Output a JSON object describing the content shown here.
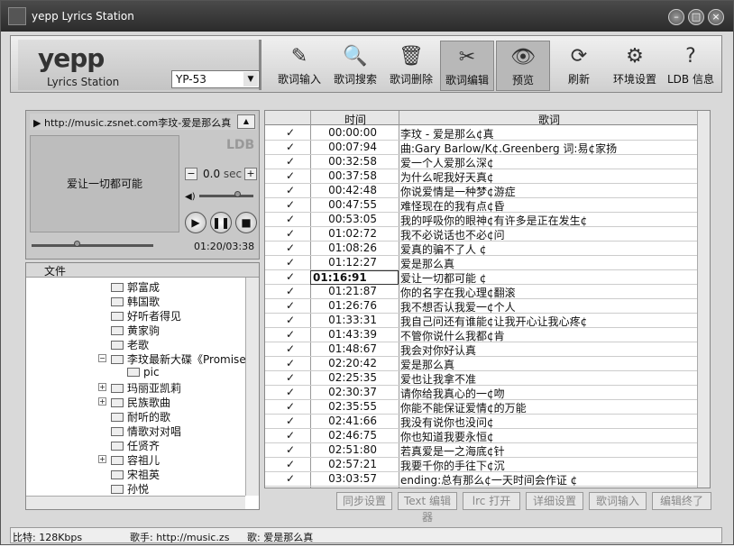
{
  "window": {
    "title": "yepp Lyrics Station"
  },
  "brand": {
    "name": "yepp",
    "subtitle": "Lyrics Station",
    "model": "YP-53"
  },
  "toolbar": [
    {
      "label": "歌词输入",
      "icon": "lyrics-input-icon"
    },
    {
      "label": "歌词搜索",
      "icon": "lyrics-search-icon"
    },
    {
      "label": "歌词删除",
      "icon": "trash-icon"
    },
    {
      "label": "歌词编辑",
      "icon": "scissors-icon",
      "active": true
    },
    {
      "label": "预览",
      "icon": "eye-icon",
      "active": true
    },
    {
      "label": "刷新",
      "icon": "refresh-icon"
    },
    {
      "label": "环境设置",
      "icon": "settings-icon"
    },
    {
      "label": "LDB 信息",
      "icon": "help-icon"
    }
  ],
  "player": {
    "url": "http://music.zsnet.com李玟-爱是那么真",
    "lyric": "爱让一切都可能",
    "sec_value": "0.0",
    "sec_label": "sec",
    "time": "01:20/03:38",
    "progress": 0.37,
    "volume": 0.7
  },
  "tree": {
    "header": "文件",
    "items": [
      {
        "label": "郭富成",
        "indent": 1
      },
      {
        "label": "韩国歌",
        "indent": 1
      },
      {
        "label": "好听者得见",
        "indent": 1
      },
      {
        "label": "黄家驹",
        "indent": 1
      },
      {
        "label": "老歌",
        "indent": 1
      },
      {
        "label": "李玟最新大碟《Promise",
        "indent": 1,
        "expanded": true
      },
      {
        "label": "pic",
        "indent": 2
      },
      {
        "label": "玛丽亚凯莉",
        "indent": 1,
        "plus": true
      },
      {
        "label": "民族歌曲",
        "indent": 1,
        "plus": true
      },
      {
        "label": "耐听的歌",
        "indent": 1
      },
      {
        "label": "情歌对对唱",
        "indent": 1
      },
      {
        "label": "任贤齐",
        "indent": 1
      },
      {
        "label": "容祖儿",
        "indent": 1,
        "plus": true
      },
      {
        "label": "宋祖英",
        "indent": 1
      },
      {
        "label": "孙悦",
        "indent": 1
      }
    ]
  },
  "grid": {
    "col_time": "时间",
    "col_lyrics": "歌词",
    "rows": [
      {
        "t": "00:00:00",
        "l": "李玟 - 爱是那么¢真"
      },
      {
        "t": "00:07:94",
        "l": "曲:Gary Barlow/K¢.Greenberg 词:易¢家扬"
      },
      {
        "t": "00:32:58",
        "l": "爱一个人爱那么深¢"
      },
      {
        "t": "00:37:58",
        "l": "为什么呢我好天真¢"
      },
      {
        "t": "00:42:48",
        "l": "你说爱情是一种梦¢游症"
      },
      {
        "t": "00:47:55",
        "l": "难怪现在的我有点¢昏"
      },
      {
        "t": "00:53:05",
        "l": "我的呼吸你的眼神¢有许多是正在发生¢"
      },
      {
        "t": "01:02:72",
        "l": "我不必说话也不必¢问"
      },
      {
        "t": "01:08:26",
        "l": "爱真的骗不了人 ¢"
      },
      {
        "t": "01:12:27",
        "l": "爱是那么真"
      },
      {
        "t": "01:16:91",
        "l": "爱让一切都可能 ¢",
        "editing": true
      },
      {
        "t": "01:21:87",
        "l": "你的名字在我心理¢翻滚"
      },
      {
        "t": "01:26:76",
        "l": "我不想否认我爱一¢个人"
      },
      {
        "t": "01:33:31",
        "l": "我自己问还有谁能¢让我开心让我心疼¢"
      },
      {
        "t": "01:43:39",
        "l": "不管你说什么我都¢肯"
      },
      {
        "t": "01:48:67",
        "l": "我会对你好认真"
      },
      {
        "t": "02:20:42",
        "l": "爱是那么真"
      },
      {
        "t": "02:25:35",
        "l": "爱也让我拿不准"
      },
      {
        "t": "02:30:37",
        "l": "请你给我真心的一¢吻"
      },
      {
        "t": "02:35:55",
        "l": "你能不能保证爱情¢的万能"
      },
      {
        "t": "02:41:66",
        "l": "我没有说你也没问¢"
      },
      {
        "t": "02:46:75",
        "l": "你也知道我要永恒¢"
      },
      {
        "t": "02:51:80",
        "l": "若真爱是一之海底¢针"
      },
      {
        "t": "02:57:21",
        "l": "我要千你的手往下¢沉"
      },
      {
        "t": "03:03:57",
        "l": "ending:总有那么¢一天时间会作证 ¢"
      }
    ]
  },
  "buttons": [
    "同步设置",
    "Text 编辑器",
    "lrc 打开",
    "详细设置",
    "歌词输入",
    "编辑终了"
  ],
  "status": {
    "bitrate": "比特: 128Kbps",
    "singer": "歌手: http://music.zs",
    "song": "歌: 爱是那么真"
  }
}
